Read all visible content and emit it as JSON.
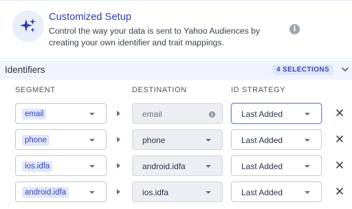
{
  "setup": {
    "title": "Customized Setup",
    "description": "Control the way your data is sent to Yahoo Audiences by creating your own identifier and trait mappings.",
    "icon": "sparkle-icon",
    "info_icon": "info-icon"
  },
  "identifiers": {
    "title": "Identifiers",
    "badge": "4 SELECTIONS",
    "collapse_icon": "chevron-down-icon"
  },
  "columns": {
    "segment": "SEGMENT",
    "destination": "DESTINATION",
    "id_strategy": "ID STRATEGY"
  },
  "rows": [
    {
      "segment": "email",
      "destination": "email",
      "destination_editable": false,
      "strategy": "Last Added",
      "strategy_focused": true
    },
    {
      "segment": "phone",
      "destination": "phone",
      "destination_editable": true,
      "strategy": "Last Added",
      "strategy_focused": false
    },
    {
      "segment": "ios.idfa",
      "destination": "android.idfa",
      "destination_editable": true,
      "strategy": "Last Added",
      "strategy_focused": false
    },
    {
      "segment": "android.idfa",
      "destination": "ios.idfa",
      "destination_editable": true,
      "strategy": "Last Added",
      "strategy_focused": false
    }
  ],
  "colors": {
    "accent": "#2d3aa8",
    "chip_bg": "#e2e8fb",
    "header_bg": "#f1f4fc"
  }
}
